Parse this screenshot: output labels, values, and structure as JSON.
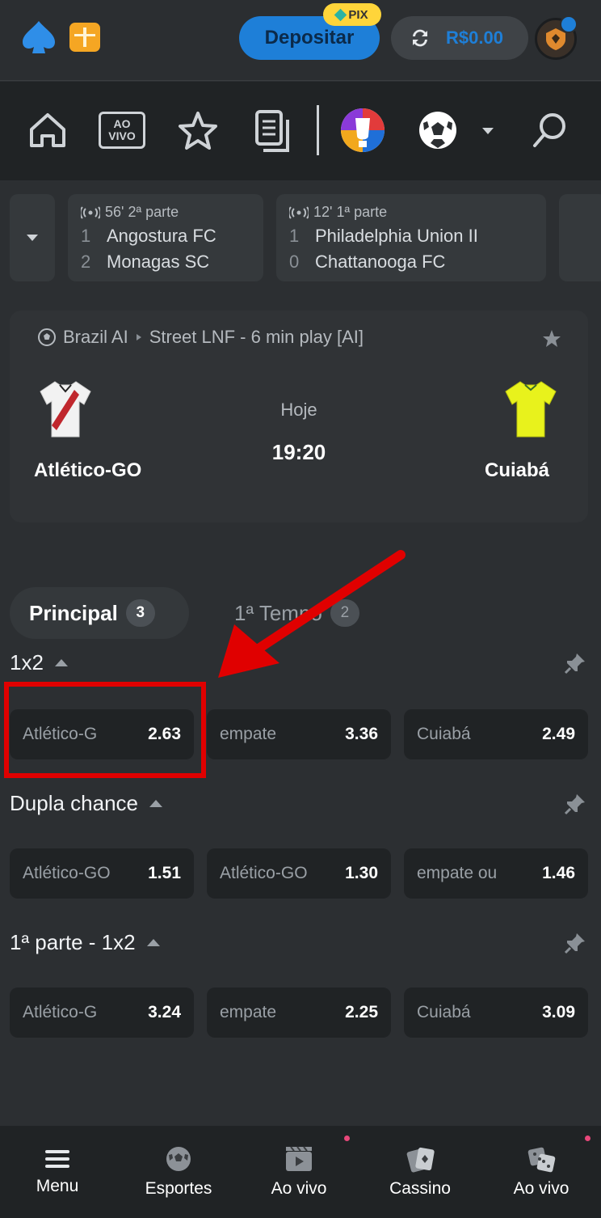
{
  "header": {
    "deposit_label": "Depositar",
    "pix_label": "PIX",
    "balance": "R$0.00",
    "logo_icon": "spade-logo-icon",
    "gift_icon": "gift-icon",
    "accent_color": "#1e7fd8"
  },
  "nav": {
    "items": [
      "home-icon",
      "ao-vivo-icon",
      "star-icon",
      "betslip-icon",
      "euro-icon",
      "soccer-ball-icon",
      "chevron-down-icon",
      "search-icon"
    ],
    "ao_vivo_line1": "AO",
    "ao_vivo_line2": "VIVO"
  },
  "live_matches": [
    {
      "time": "56' 2ª parte",
      "home_score": "1",
      "home": "Angostura FC",
      "away_score": "2",
      "away": "Monagas SC"
    },
    {
      "time": "12' 1ª parte",
      "home_score": "1",
      "home": "Philadelphia Union II",
      "away_score": "0",
      "away": "Chattanooga FC"
    }
  ],
  "event": {
    "league": "Brazil AI",
    "competition": "Street LNF - 6 min play [AI]",
    "home_team": "Atlético-GO",
    "away_team": "Cuiabá",
    "day": "Hoje",
    "time": "19:20",
    "home_shirt_color": "#f2f2f2",
    "away_shirt_color": "#e8f21c"
  },
  "tabs": [
    {
      "label": "Principal",
      "count": "3"
    },
    {
      "label": "1ª Tempo",
      "count": "2"
    }
  ],
  "markets": [
    {
      "title": "1x2",
      "odds": [
        {
          "label": "Atlético-G",
          "value": "2.63"
        },
        {
          "label": "empate",
          "value": "3.36"
        },
        {
          "label": "Cuiabá",
          "value": "2.49"
        }
      ]
    },
    {
      "title": "Dupla chance",
      "odds": [
        {
          "label": "Atlético-GO",
          "value": "1.51"
        },
        {
          "label": "Atlético-GO",
          "value": "1.30"
        },
        {
          "label": "empate ou",
          "value": "1.46"
        }
      ]
    },
    {
      "title": "1ª parte - 1x2",
      "odds": [
        {
          "label": "Atlético-G",
          "value": "3.24"
        },
        {
          "label": "empate",
          "value": "2.25"
        },
        {
          "label": "Cuiabá",
          "value": "3.09"
        }
      ]
    }
  ],
  "bottom_nav": [
    {
      "label": "Menu",
      "icon": "menu-icon"
    },
    {
      "label": "Esportes",
      "icon": "soccer-ball-icon"
    },
    {
      "label": "Ao vivo",
      "icon": "video-icon"
    },
    {
      "label": "Cassino",
      "icon": "cards-icon"
    },
    {
      "label": "Ao vivo",
      "icon": "dice-icon"
    }
  ],
  "annotation_color": "#e00000"
}
